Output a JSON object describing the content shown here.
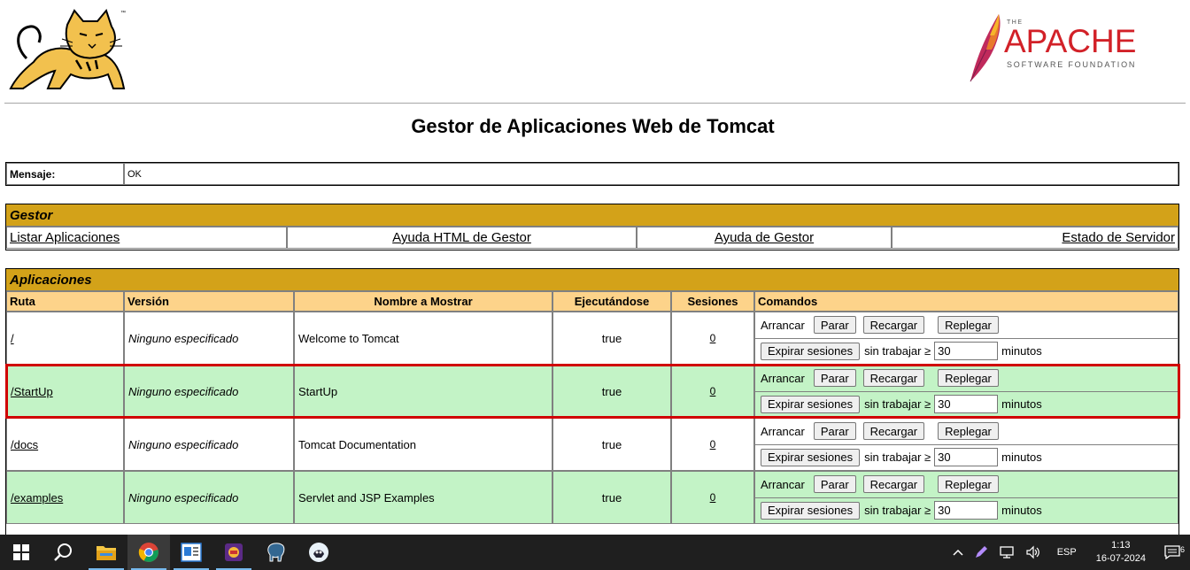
{
  "page": {
    "title": "Gestor de Aplicaciones Web de Tomcat",
    "apache": {
      "the": "THE",
      "word": "APACHE",
      "sub": "SOFTWARE FOUNDATION"
    }
  },
  "message": {
    "label": "Mensaje:",
    "value": "OK"
  },
  "manager": {
    "heading": "Gestor",
    "links": [
      "Listar Aplicaciones",
      "Ayuda HTML de Gestor",
      "Ayuda de Gestor",
      "Estado de Servidor"
    ]
  },
  "applications": {
    "heading": "Aplicaciones",
    "columns": [
      "Ruta",
      "Versión",
      "Nombre a Mostrar",
      "Ejecutándose",
      "Sesiones",
      "Comandos"
    ],
    "rows": [
      {
        "path": "/",
        "version": "Ninguno especificado",
        "name": "Welcome to Tomcat",
        "running": "true",
        "sessions": "0"
      },
      {
        "path": "/StartUp",
        "version": "Ninguno especificado",
        "name": "StartUp",
        "running": "true",
        "sessions": "0"
      },
      {
        "path": "/docs",
        "version": "Ninguno especificado",
        "name": "Tomcat Documentation",
        "running": "true",
        "sessions": "0"
      },
      {
        "path": "/examples",
        "version": "Ninguno especificado",
        "name": "Servlet and JSP Examples",
        "running": "true",
        "sessions": "0"
      }
    ],
    "commands": {
      "start": "Arrancar",
      "stop": "Parar",
      "reload": "Recargar",
      "undeploy": "Replegar",
      "expire": "Expirar sesiones",
      "idle": "sin trabajar ≥",
      "idle_value": "30",
      "minutes": "minutos"
    }
  },
  "taskbar": {
    "language": "ESP",
    "time": "1:13",
    "date": "16-07-2024",
    "notifications": "6"
  }
}
